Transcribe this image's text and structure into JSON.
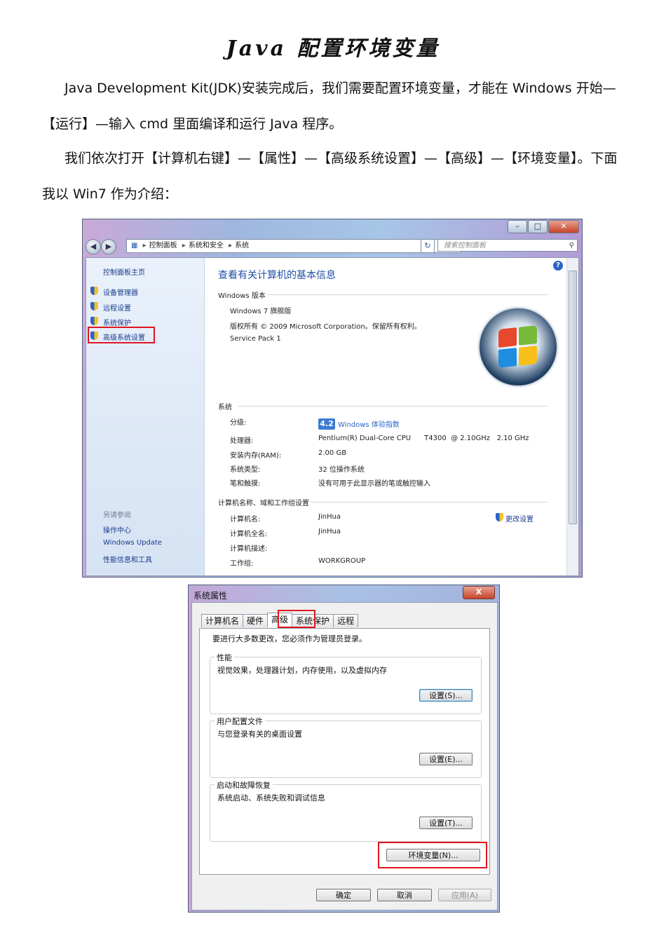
{
  "doc": {
    "title": "Java 配置环境变量",
    "para1": "Java Development Kit(JDK)安装完成后，我们需要配置环境变量，才能在 Windows 开始—【运行】—输入 cmd 里面编译和运行 Java 程序。",
    "para2": "我们依次打开【计算机右键】—【属性】—【高级系统设置】—【高级】—【环境变量】。下面我以 Win7 作为介绍："
  },
  "control_panel": {
    "breadcrumb": [
      "控制面板",
      "系统和安全",
      "系统"
    ],
    "search_placeholder": "搜索控制面板",
    "sidebar": {
      "home": "控制面板主页",
      "items": [
        {
          "label": "设备管理器"
        },
        {
          "label": "远程设置"
        },
        {
          "label": "系统保护"
        },
        {
          "label": "高级系统设置"
        }
      ],
      "see_also_title": "另请参阅",
      "see_also": [
        "操作中心",
        "Windows Update",
        "性能信息和工具"
      ]
    },
    "main_title": "查看有关计算机的基本信息",
    "edition": {
      "heading": "Windows 版本",
      "name": "Windows 7 旗舰版",
      "copyright": "版权所有 © 2009 Microsoft Corporation。保留所有权利。",
      "service_pack": "Service Pack 1"
    },
    "system": {
      "heading": "系统",
      "rating_label": "分级:",
      "rating_score": "4.2",
      "rating_text": "Windows 体验指数",
      "processor_label": "处理器:",
      "processor_value": "Pentium(R) Dual-Core CPU      T4300  @ 2.10GHz   2.10 GHz",
      "ram_label": "安装内存(RAM):",
      "ram_value": "2.00 GB",
      "type_label": "系统类型:",
      "type_value": "32 位操作系统",
      "pen_label": "笔和触摸:",
      "pen_value": "没有可用于此显示器的笔或触控输入"
    },
    "computer": {
      "heading": "计算机名称、域和工作组设置",
      "name_label": "计算机名:",
      "name_value": "JinHua",
      "fullname_label": "计算机全名:",
      "fullname_value": "JinHua",
      "desc_label": "计算机描述:",
      "workgroup_label": "工作组:",
      "workgroup_value": "WORKGROUP",
      "change_link": "更改设置"
    }
  },
  "sys_props": {
    "title": "系统属性",
    "close": "X",
    "tabs": [
      "计算机名",
      "硬件",
      "高级",
      "系统保护",
      "远程"
    ],
    "notice": "要进行大多数更改，您必须作为管理员登录。",
    "performance": {
      "title": "性能",
      "desc": "视觉效果，处理器计划，内存使用，以及虚拟内存",
      "button": "设置(S)..."
    },
    "profiles": {
      "title": "用户配置文件",
      "desc": "与您登录有关的桌面设置",
      "button": "设置(E)..."
    },
    "startup": {
      "title": "启动和故障恢复",
      "desc": "系统启动、系统失败和调试信息",
      "button": "设置(T)..."
    },
    "env_button": "环境变量(N)...",
    "ok": "确定",
    "cancel": "取消",
    "apply": "应用(A)"
  },
  "colors": {
    "highlight": "#e0161f",
    "link": "#1a3b8c",
    "title_blue": "#1f4fa6"
  }
}
